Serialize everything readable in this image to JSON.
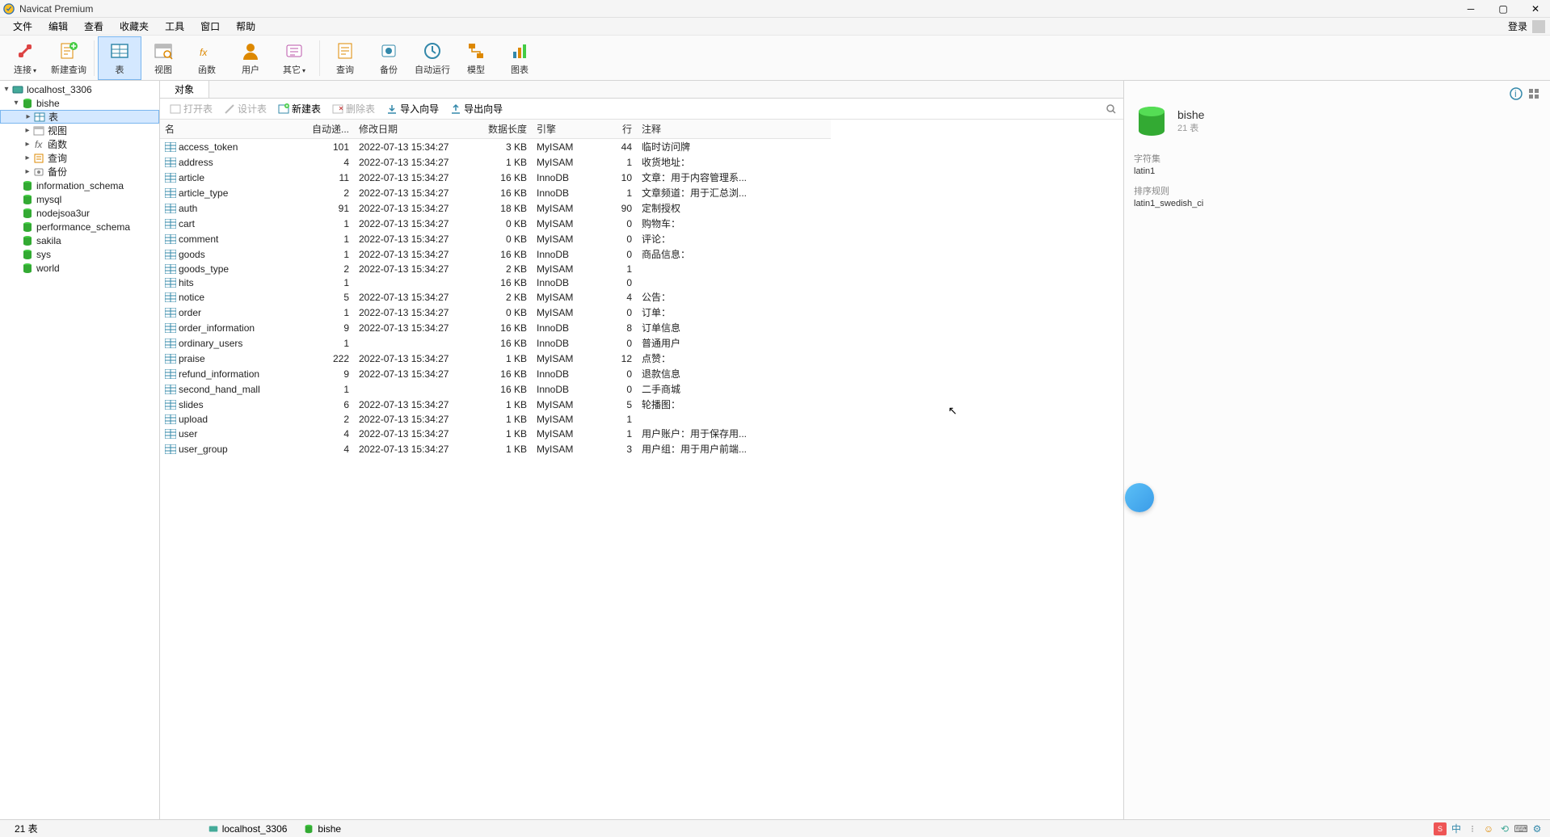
{
  "app": {
    "title": "Navicat Premium",
    "login": "登录"
  },
  "menu": [
    "文件",
    "编辑",
    "查看",
    "收藏夹",
    "工具",
    "窗口",
    "帮助"
  ],
  "toolbar": [
    {
      "label": "连接",
      "icon": "connection"
    },
    {
      "label": "新建查询",
      "icon": "new-query"
    },
    {
      "label": "表",
      "icon": "table",
      "active": true
    },
    {
      "label": "视图",
      "icon": "view"
    },
    {
      "label": "函数",
      "icon": "function"
    },
    {
      "label": "用户",
      "icon": "user"
    },
    {
      "label": "其它",
      "icon": "other"
    },
    {
      "label": "查询",
      "icon": "query"
    },
    {
      "label": "备份",
      "icon": "backup"
    },
    {
      "label": "自动运行",
      "icon": "autorun"
    },
    {
      "label": "模型",
      "icon": "model"
    },
    {
      "label": "图表",
      "icon": "chart"
    }
  ],
  "tree": {
    "connection": "localhost_3306",
    "current_db": "bishe",
    "db_children": [
      "表",
      "视图",
      "函数",
      "查询",
      "备份"
    ],
    "other_dbs": [
      "information_schema",
      "mysql",
      "nodejsoa3ur",
      "performance_schema",
      "sakila",
      "sys",
      "world"
    ]
  },
  "tab": {
    "active": "对象"
  },
  "obj_toolbar": {
    "open": "打开表",
    "design": "设计表",
    "new": "新建表",
    "delete": "删除表",
    "import": "导入向导",
    "export": "导出向导"
  },
  "columns": [
    "名",
    "自动递...",
    "修改日期",
    "数据长度",
    "引擎",
    "行",
    "注释"
  ],
  "tables": [
    {
      "name": "access_token",
      "auto": 101,
      "modified": "2022-07-13 15:34:27",
      "size": "3 KB",
      "engine": "MyISAM",
      "rows": 44,
      "comment": "临时访问牌"
    },
    {
      "name": "address",
      "auto": 4,
      "modified": "2022-07-13 15:34:27",
      "size": "1 KB",
      "engine": "MyISAM",
      "rows": 1,
      "comment": "收货地址："
    },
    {
      "name": "article",
      "auto": 11,
      "modified": "2022-07-13 15:34:27",
      "size": "16 KB",
      "engine": "InnoDB",
      "rows": 10,
      "comment": "文章：用于内容管理系..."
    },
    {
      "name": "article_type",
      "auto": 2,
      "modified": "2022-07-13 15:34:27",
      "size": "16 KB",
      "engine": "InnoDB",
      "rows": 1,
      "comment": "文章频道：用于汇总浏..."
    },
    {
      "name": "auth",
      "auto": 91,
      "modified": "2022-07-13 15:34:27",
      "size": "18 KB",
      "engine": "MyISAM",
      "rows": 90,
      "comment": "定制授权"
    },
    {
      "name": "cart",
      "auto": 1,
      "modified": "2022-07-13 15:34:27",
      "size": "0 KB",
      "engine": "MyISAM",
      "rows": 0,
      "comment": "购物车："
    },
    {
      "name": "comment",
      "auto": 1,
      "modified": "2022-07-13 15:34:27",
      "size": "0 KB",
      "engine": "MyISAM",
      "rows": 0,
      "comment": "评论："
    },
    {
      "name": "goods",
      "auto": 1,
      "modified": "2022-07-13 15:34:27",
      "size": "16 KB",
      "engine": "InnoDB",
      "rows": 0,
      "comment": "商品信息："
    },
    {
      "name": "goods_type",
      "auto": 2,
      "modified": "2022-07-13 15:34:27",
      "size": "2 KB",
      "engine": "MyISAM",
      "rows": 1,
      "comment": ""
    },
    {
      "name": "hits",
      "auto": 1,
      "modified": "",
      "size": "16 KB",
      "engine": "InnoDB",
      "rows": 0,
      "comment": ""
    },
    {
      "name": "notice",
      "auto": 5,
      "modified": "2022-07-13 15:34:27",
      "size": "2 KB",
      "engine": "MyISAM",
      "rows": 4,
      "comment": "公告："
    },
    {
      "name": "order",
      "auto": 1,
      "modified": "2022-07-13 15:34:27",
      "size": "0 KB",
      "engine": "MyISAM",
      "rows": 0,
      "comment": "订单："
    },
    {
      "name": "order_information",
      "auto": 9,
      "modified": "2022-07-13 15:34:27",
      "size": "16 KB",
      "engine": "InnoDB",
      "rows": 8,
      "comment": "订单信息"
    },
    {
      "name": "ordinary_users",
      "auto": 1,
      "modified": "",
      "size": "16 KB",
      "engine": "InnoDB",
      "rows": 0,
      "comment": "普通用户"
    },
    {
      "name": "praise",
      "auto": 222,
      "modified": "2022-07-13 15:34:27",
      "size": "1 KB",
      "engine": "MyISAM",
      "rows": 12,
      "comment": "点赞："
    },
    {
      "name": "refund_information",
      "auto": 9,
      "modified": "2022-07-13 15:34:27",
      "size": "16 KB",
      "engine": "InnoDB",
      "rows": 0,
      "comment": "退款信息"
    },
    {
      "name": "second_hand_mall",
      "auto": 1,
      "modified": "",
      "size": "16 KB",
      "engine": "InnoDB",
      "rows": 0,
      "comment": "二手商城"
    },
    {
      "name": "slides",
      "auto": 6,
      "modified": "2022-07-13 15:34:27",
      "size": "1 KB",
      "engine": "MyISAM",
      "rows": 5,
      "comment": "轮播图："
    },
    {
      "name": "upload",
      "auto": 2,
      "modified": "2022-07-13 15:34:27",
      "size": "1 KB",
      "engine": "MyISAM",
      "rows": 1,
      "comment": ""
    },
    {
      "name": "user",
      "auto": 4,
      "modified": "2022-07-13 15:34:27",
      "size": "1 KB",
      "engine": "MyISAM",
      "rows": 1,
      "comment": "用户账户：用于保存用..."
    },
    {
      "name": "user_group",
      "auto": 4,
      "modified": "2022-07-13 15:34:27",
      "size": "1 KB",
      "engine": "MyISAM",
      "rows": 3,
      "comment": "用户组：用于用户前端..."
    }
  ],
  "info": {
    "db_name": "bishe",
    "db_sub": "21 表",
    "charset_label": "字符集",
    "charset": "latin1",
    "collation_label": "排序规则",
    "collation": "latin1_swedish_ci"
  },
  "status": {
    "count": "21 表",
    "conn": "localhost_3306",
    "db": "bishe"
  }
}
